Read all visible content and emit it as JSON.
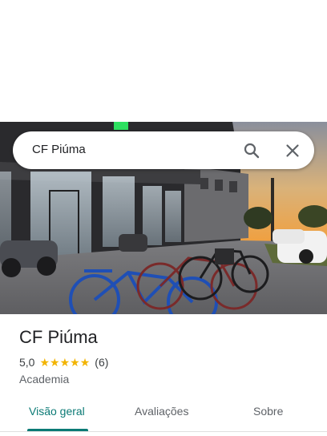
{
  "search": {
    "query": "CF Piúma",
    "search_icon": "search-icon",
    "close_icon": "close-icon"
  },
  "place": {
    "name": "CF Piúma",
    "rating": "5,0",
    "stars": 5,
    "review_count": "(6)",
    "category": "Academia",
    "star_color": "#f2b401"
  },
  "tabs": [
    {
      "label": "Visão geral",
      "active": true
    },
    {
      "label": "Avaliações",
      "active": false
    },
    {
      "label": "Sobre",
      "active": false
    }
  ],
  "colors": {
    "accent": "#0b7a75",
    "text": "#202124",
    "secondary_text": "#5f6368"
  }
}
